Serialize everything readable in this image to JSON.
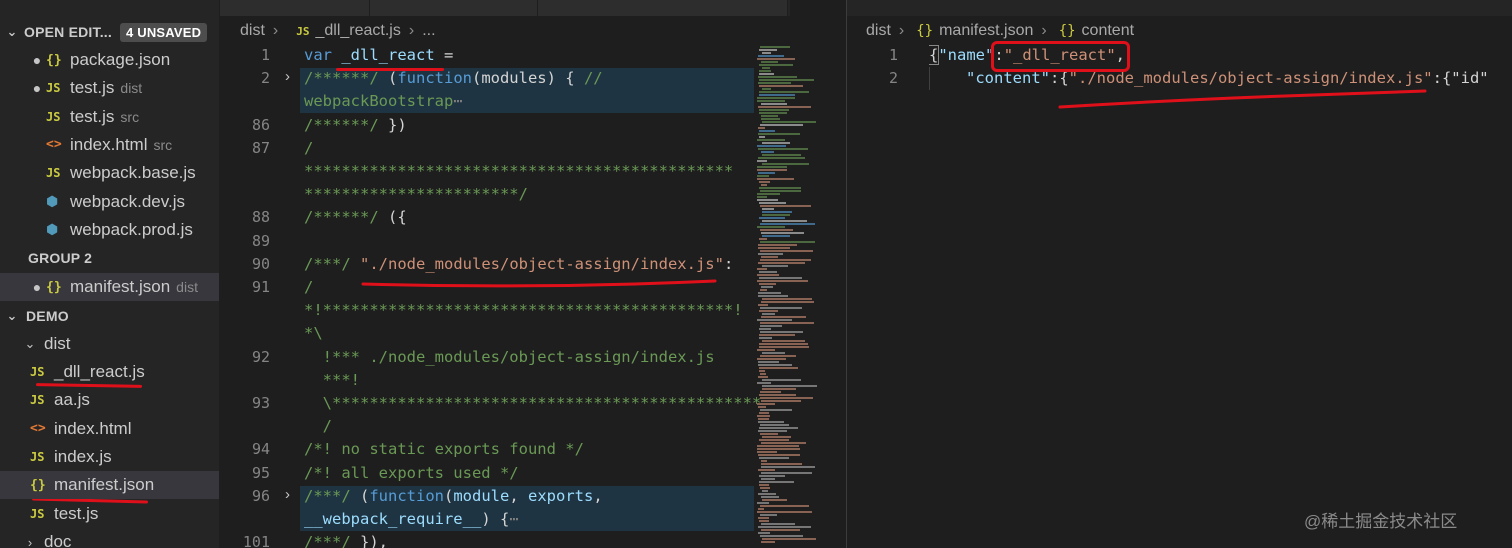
{
  "sidebar": {
    "open_editors": {
      "title": "OPEN EDIT...",
      "badge": "4 UNSAVED"
    },
    "group1_items": [
      {
        "dot": "●",
        "icon": "{}",
        "name": "package.json",
        "desc": ""
      },
      {
        "dot": "●",
        "icon": "JS",
        "name": "test.js",
        "desc": "dist"
      },
      {
        "dot": "",
        "icon": "JS",
        "name": "test.js",
        "desc": "src"
      },
      {
        "dot": "",
        "icon": "<>",
        "name": "index.html",
        "desc": "src"
      },
      {
        "dot": "",
        "icon": "JS",
        "name": "webpack.base.js",
        "desc": ""
      },
      {
        "dot": "",
        "icon": "cube",
        "name": "webpack.dev.js",
        "desc": ""
      },
      {
        "dot": "",
        "icon": "cube",
        "name": "webpack.prod.js",
        "desc": ""
      }
    ],
    "group2_title": "GROUP 2",
    "group2_items": [
      {
        "dot": "●",
        "icon": "{}",
        "name": "manifest.json",
        "desc": "dist"
      }
    ],
    "demo_title": "DEMO",
    "dist_folder": "dist",
    "dist_items": [
      {
        "icon": "JS",
        "name": "_dll_react.js"
      },
      {
        "icon": "JS",
        "name": "aa.js"
      },
      {
        "icon": "<>",
        "name": "index.html"
      },
      {
        "icon": "JS",
        "name": "index.js"
      },
      {
        "icon": "{}",
        "name": "manifest.json"
      },
      {
        "icon": "JS",
        "name": "test.js"
      }
    ],
    "doc_folder": "doc"
  },
  "left_editor": {
    "breadcrumb": {
      "folder": "dist",
      "file_icon": "JS",
      "file": "_dll_react.js",
      "more": "..."
    },
    "line_numbers": [
      "1",
      "2",
      "86",
      "87",
      "88",
      "89",
      "90",
      "91",
      "92",
      "93",
      "94",
      "95",
      "96",
      "101"
    ],
    "lines": [
      {
        "t": "var",
        "v": " _dll_react",
        "x": " ="
      },
      {
        "c": "/******/",
        "x": " (",
        "k": "function",
        "y": "(modules) { ",
        "c2": "//"
      },
      {
        "c": "webpackBootstrap",
        "e": "⋯"
      },
      {
        "c": "/******/",
        "x": " })"
      },
      {
        "c": "/"
      },
      {
        "c": "**********************************************"
      },
      {
        "c": "***********************/"
      },
      {
        "c": "/******/",
        "x": " ({"
      },
      {
        "x": ""
      },
      {
        "c": "/***/",
        "x": " ",
        "s": "\"./node_modules/object-assign/index.js\"",
        "y": ":"
      },
      {
        "c": "/"
      },
      {
        "c": "*!********************************************!"
      },
      {
        "c": "*\\"
      },
      {
        "c": "  !*** ./node_modules/object-assign/index.js"
      },
      {
        "c": "  ***!"
      },
      {
        "c": "  \\**********************************************"
      },
      {
        "c": "  /"
      },
      {
        "c": "/*! no static exports found */"
      },
      {
        "c": "/*! all exports used */"
      },
      {
        "c": "/***/",
        "x": " (",
        "k": "function",
        "y": "(",
        "v": "module",
        "x2": ", ",
        "v2": "exports",
        "y2": ","
      },
      {
        "v": "__webpack_require__",
        "x": ") {",
        "e": "⋯"
      },
      {
        "c": "/***/",
        "x": " }),"
      }
    ]
  },
  "right_editor": {
    "breadcrumb": {
      "folder": "dist",
      "file_icon": "{}",
      "file": "manifest.json",
      "node_icon": "{}",
      "node": "content"
    },
    "line_numbers": [
      "1",
      "2"
    ],
    "line1": {
      "open": "{",
      "key": "\"name\"",
      "colon": ":",
      "value": "\"_dll_react\"",
      "comma": ","
    },
    "line2": {
      "key": "\"content\"",
      "mid": ":{",
      "value": "\"./node_modules/object-assign/index.js\"",
      "tail": ":{\"id\""
    }
  },
  "watermark": "@稀土掘金技术社区"
}
